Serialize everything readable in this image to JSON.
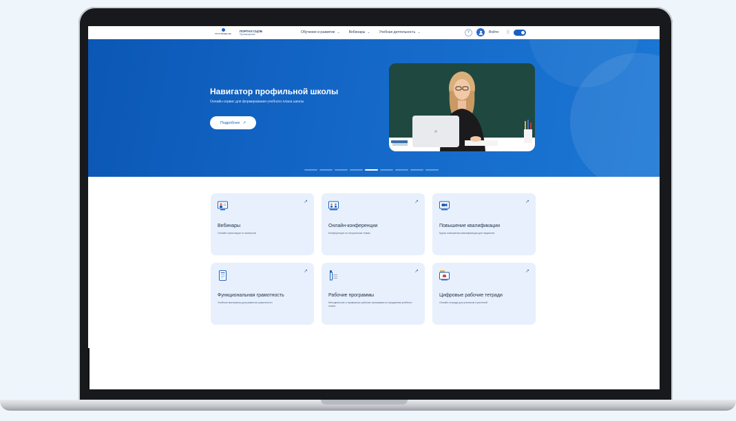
{
  "header": {
    "logo_mark": "5",
    "logo_mark_sub": "ПРОСВЕЩЕНИЕ",
    "logo_title": "ПОРТАЛ СЦОБ",
    "logo_sub": "Просвещение",
    "nav": [
      {
        "label": "Обучение и развитие"
      },
      {
        "label": "Вебинары"
      },
      {
        "label": "Учебная деятельность"
      }
    ],
    "accessibility_label": "Y",
    "login_label": "Войти"
  },
  "hero": {
    "title": "Навигатор профильной школы",
    "subtitle": "Онлайн-сервис для формирования учебного плана школы",
    "button_label": "Подробнее",
    "button_arrow": "↗",
    "slides_count": 9,
    "active_slide": 5
  },
  "cards": [
    {
      "title": "Вебинары",
      "desc": "Онлайн-трансляции от экспертов",
      "icon": "webinar-icon"
    },
    {
      "title": "Онлайн-конференции",
      "desc": "Конференции по актуальным темам",
      "icon": "conference-icon"
    },
    {
      "title": "Повышение квалификации",
      "desc": "Курсы повышения квалификации для педагогов",
      "icon": "video-camera-icon"
    },
    {
      "title": "Функциональная грамотность",
      "desc": "Учебные материалы для развития грамотности",
      "icon": "document-icon"
    },
    {
      "title": "Рабочие программы",
      "desc": "Методические и примерные рабочие программы по предметам учебного плана",
      "icon": "program-icon"
    },
    {
      "title": "Цифровые рабочие тетради",
      "desc": "Онлайн-тетради для учеников и учителей",
      "icon": "notebook-icon"
    }
  ],
  "colors": {
    "brand": "#1b5fbf",
    "hero_bg": "#0b57b5",
    "card_bg": "#e7f0fc"
  }
}
